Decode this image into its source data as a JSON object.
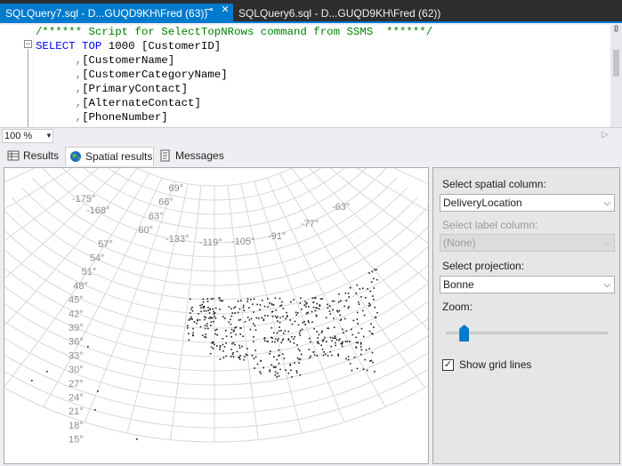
{
  "tabs": [
    {
      "label": "SQLQuery7.sql - D...GUQD9KH\\Fred (63))",
      "pin": "⊸",
      "close": "✕"
    },
    {
      "label": "SQLQuery6.sql - D...GUQD9KH\\Fred (62))"
    }
  ],
  "editor": {
    "collapse": "−",
    "lines": [
      [
        [
          "cm",
          "/****** Script for SelectTopNRows command from SSMS  ******/"
        ]
      ],
      [
        [
          "kw",
          "SELECT TOP "
        ],
        [
          "id",
          "1000 [CustomerID]"
        ]
      ],
      [
        [
          "id",
          "      "
        ],
        [
          "op",
          ","
        ],
        [
          "id",
          "[CustomerName]"
        ]
      ],
      [
        [
          "id",
          "      "
        ],
        [
          "op",
          ","
        ],
        [
          "id",
          "[CustomerCategoryName]"
        ]
      ],
      [
        [
          "id",
          "      "
        ],
        [
          "op",
          ","
        ],
        [
          "id",
          "[PrimaryContact]"
        ]
      ],
      [
        [
          "id",
          "      "
        ],
        [
          "op",
          ","
        ],
        [
          "id",
          "[AlternateContact]"
        ]
      ],
      [
        [
          "id",
          "      "
        ],
        [
          "op",
          ","
        ],
        [
          "id",
          "[PhoneNumber]"
        ]
      ]
    ],
    "split_icon": "⇳"
  },
  "zoom": {
    "value": "100 %",
    "arrow": "▼"
  },
  "hscroll_arrow": "▷",
  "result_tabs": [
    {
      "label": "Results",
      "icon": "results-grid-icon"
    },
    {
      "label": "Spatial results",
      "icon": "globe-icon"
    },
    {
      "label": "Messages",
      "icon": "messages-icon"
    }
  ],
  "map": {
    "lat_labels": [
      "69°",
      "66°",
      "63°",
      "60°",
      "57°",
      "54°",
      "51°",
      "48°",
      "45°",
      "42°",
      "39°",
      "36°",
      "33°",
      "30°",
      "27°",
      "24°",
      "21°",
      "18°",
      "15°"
    ],
    "lon_labels": [
      "-175°",
      "-168°",
      "-133°",
      "-119°",
      "-105°",
      "-91°",
      "-77°",
      "-63°"
    ]
  },
  "panel": {
    "spatial_column_label": "Select spatial column:",
    "spatial_column_value": "DeliveryLocation",
    "label_column_label": "Select label column:",
    "label_column_value": "(None)",
    "projection_label": "Select projection:",
    "projection_value": "Bonne",
    "zoom_label": "Zoom:",
    "zoom_level": 0.1,
    "gridlines_label": "Show grid lines",
    "gridlines_checked": true,
    "check_mark": "✓",
    "chevron": "⌵"
  }
}
